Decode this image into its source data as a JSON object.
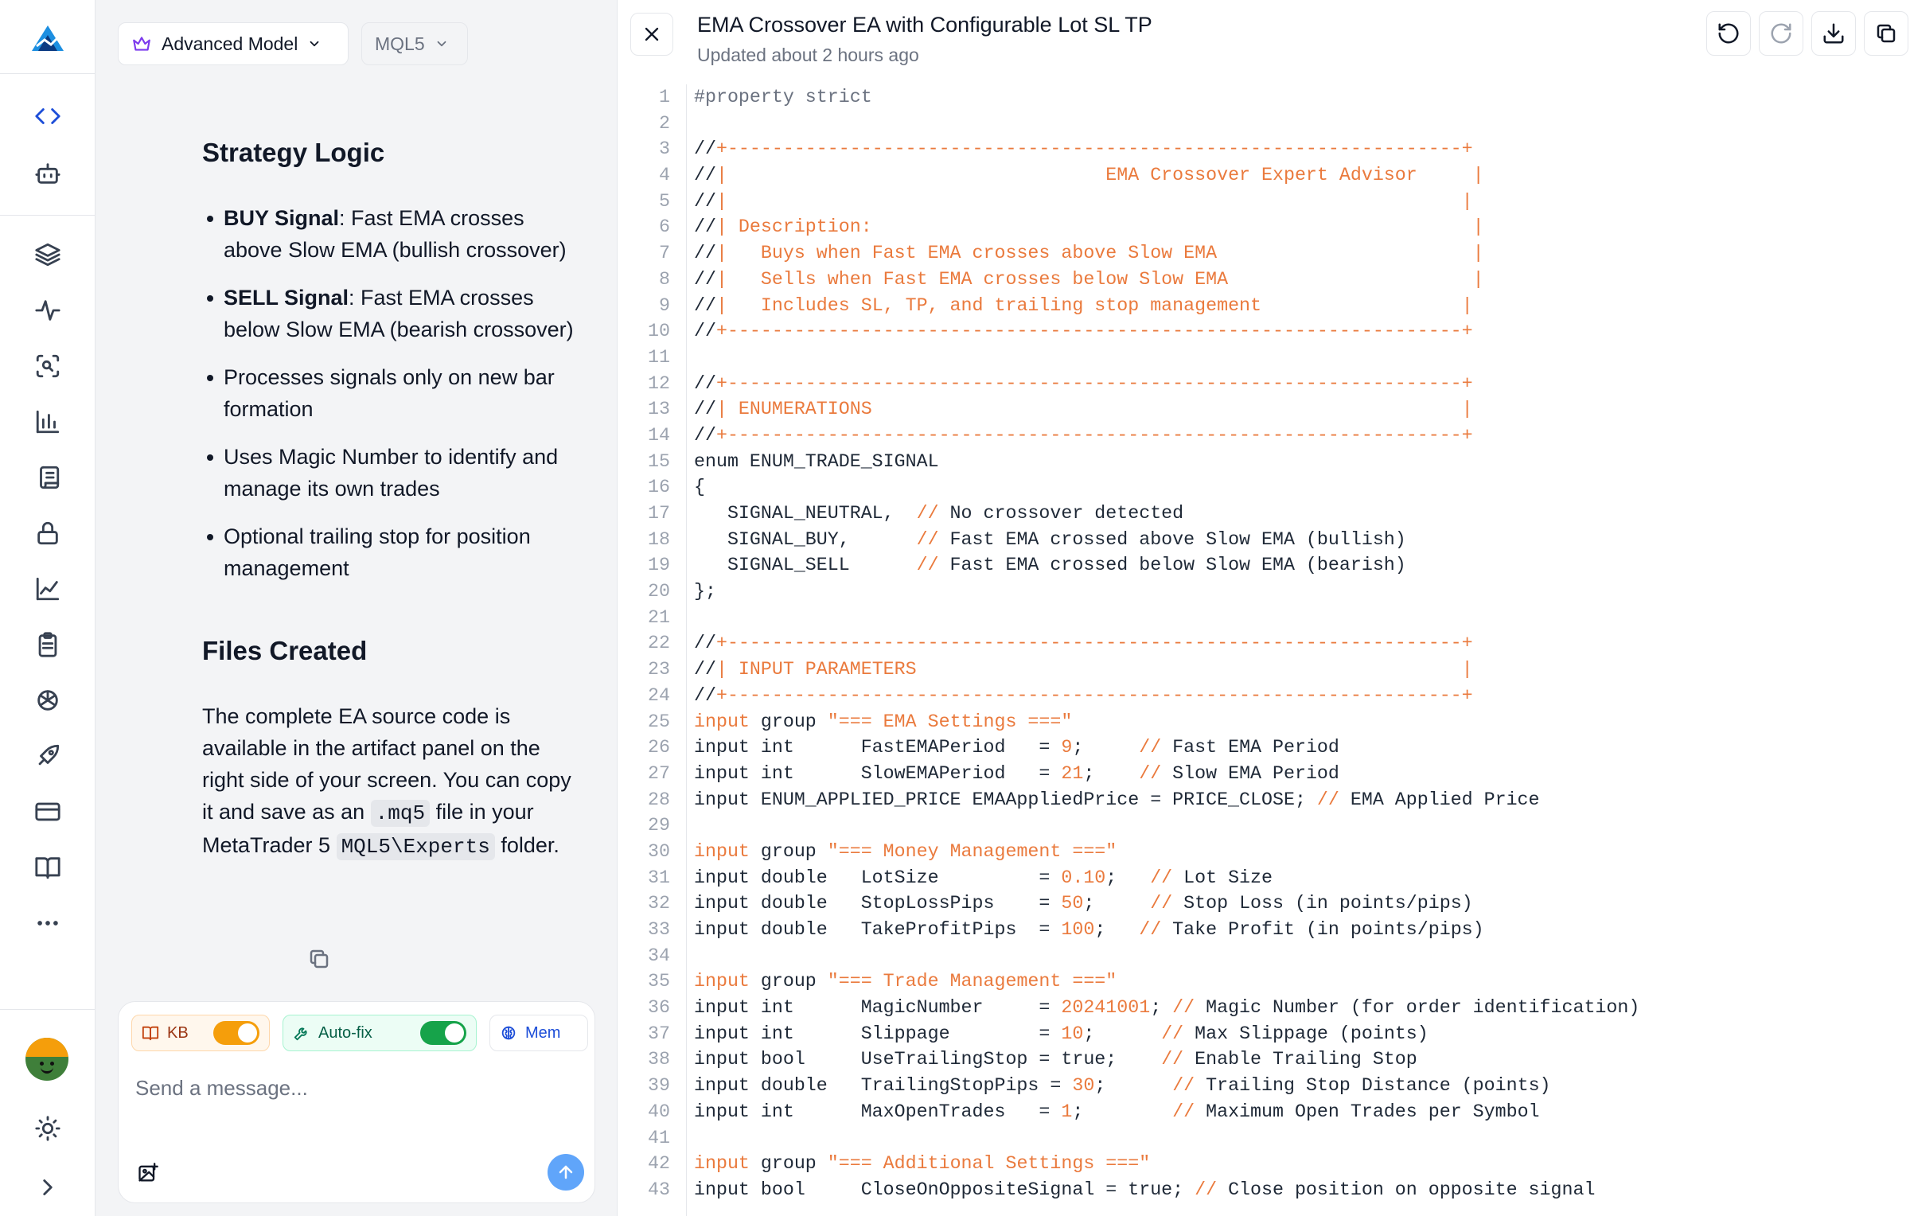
{
  "sidebar": {
    "icons": [
      "logo-icon",
      "code-icon",
      "bot-icon",
      "layers-icon",
      "pulse-icon",
      "scan-search-icon",
      "bar-chart-icon",
      "scroll-icon",
      "lock-icon",
      "line-chart-icon",
      "clipboard-icon",
      "openai-icon",
      "rocket-icon",
      "credit-card-icon",
      "book-icon",
      "more-icon",
      "avatar",
      "sun-icon",
      "expand-icon"
    ]
  },
  "chat": {
    "model_selector": "Advanced Model",
    "language_selector": "MQL5",
    "strategy_heading": "Strategy Logic",
    "bullets": [
      {
        "bold": "BUY Signal",
        "text": ": Fast EMA crosses above Slow EMA (bullish crossover)"
      },
      {
        "bold": "SELL Signal",
        "text": ": Fast EMA crosses below Slow EMA (bearish crossover)"
      },
      {
        "bold": "",
        "text": "Processes signals only on new bar formation"
      },
      {
        "bold": "",
        "text": "Uses Magic Number to identify and manage its own trades"
      },
      {
        "bold": "",
        "text": "Optional trailing stop for position management"
      }
    ],
    "files_heading": "Files Created",
    "files_text_1": "The complete EA source code is available in the artifact panel on the right side of your screen. You can copy it and save as an ",
    "files_code_1": ".mq5",
    "files_text_2": " file in your MetaTrader 5 ",
    "files_code_2": "MQL5\\Experts",
    "files_text_3": " folder.",
    "composer": {
      "kb_label": "KB",
      "autofix_label": "Auto-fix",
      "mem_label": "Mem",
      "placeholder": "Send a message..."
    }
  },
  "editor": {
    "title": "EMA Crossover EA with Configurable Lot SL TP",
    "updated": "Updated about 2 hours ago",
    "code_lines": [
      "#property strict",
      "",
      "//+------------------------------------------------------------------+",
      "//|                                  EMA Crossover Expert Advisor     |",
      "//|                                                                  |",
      "//| Description:                                                      |",
      "//|   Buys when Fast EMA crosses above Slow EMA                       |",
      "//|   Sells when Fast EMA crosses below Slow EMA                      |",
      "//|   Includes SL, TP, and trailing stop management                  |",
      "//+------------------------------------------------------------------+",
      "",
      "//+------------------------------------------------------------------+",
      "//| ENUMERATIONS                                                     |",
      "//+------------------------------------------------------------------+",
      "enum ENUM_TRADE_SIGNAL",
      "{",
      "   SIGNAL_NEUTRAL,  // No crossover detected",
      "   SIGNAL_BUY,      // Fast EMA crossed above Slow EMA (bullish)",
      "   SIGNAL_SELL      // Fast EMA crossed below Slow EMA (bearish)",
      "};",
      "",
      "//+------------------------------------------------------------------+",
      "//| INPUT PARAMETERS                                                 |",
      "//+------------------------------------------------------------------+",
      "input group \"=== EMA Settings ===\"",
      "input int      FastEMAPeriod   = 9;     // Fast EMA Period",
      "input int      SlowEMAPeriod   = 21;    // Slow EMA Period",
      "input ENUM_APPLIED_PRICE EMAAppliedPrice = PRICE_CLOSE; // EMA Applied Price",
      "",
      "input group \"=== Money Management ===\"",
      "input double   LotSize         = 0.10;   // Lot Size",
      "input double   StopLossPips    = 50;     // Stop Loss (in points/pips)",
      "input double   TakeProfitPips  = 100;   // Take Profit (in points/pips)",
      "",
      "input group \"=== Trade Management ===\"",
      "input int      MagicNumber     = 20241001; // Magic Number (for order identification)",
      "input int      Slippage        = 10;      // Max Slippage (points)",
      "input bool     UseTrailingStop = true;    // Enable Trailing Stop",
      "input double   TrailingStopPips = 30;      // Trailing Stop Distance (points)",
      "input int      MaxOpenTrades   = 1;        // Maximum Open Trades per Symbol",
      "",
      "input group \"=== Additional Settings ===\"",
      "input bool     CloseOnOppositeSignal = true; // Close position on opposite signal"
    ]
  }
}
